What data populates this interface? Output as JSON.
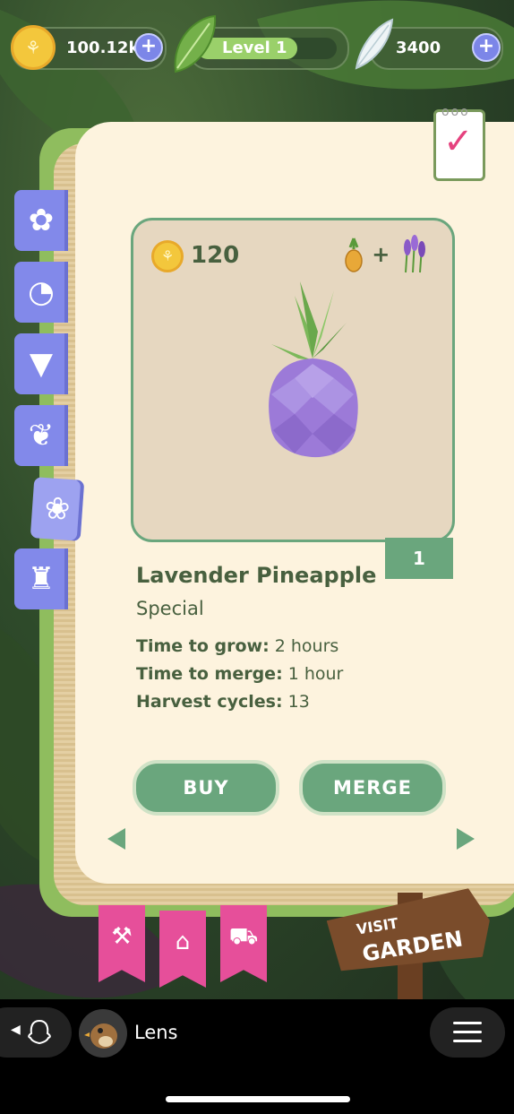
{
  "hud": {
    "coins": "100.12k",
    "level_label": "Level 1",
    "level_progress": 0.72,
    "feathers": "3400"
  },
  "categories": [
    {
      "icon": "flower-icon",
      "active": false
    },
    {
      "icon": "citrus-slice-icon",
      "active": false
    },
    {
      "icon": "carrot-icon",
      "active": false
    },
    {
      "icon": "herb-icon",
      "active": false
    },
    {
      "icon": "special-fruit-icon",
      "active": true
    },
    {
      "icon": "pedestal-icon",
      "active": false
    }
  ],
  "item": {
    "price": "120",
    "recipe": {
      "ingredient_a": "pineapple-icon",
      "operator": "+",
      "ingredient_b": "lavender-icon"
    },
    "count": "1",
    "name": "Lavender Pineapple",
    "category": "Special",
    "stats": [
      {
        "label": "Time to grow:",
        "value": "2 hours"
      },
      {
        "label": "Time to merge:",
        "value": "1 hour"
      },
      {
        "label": "Harvest cycles:",
        "value": "13"
      }
    ]
  },
  "actions": {
    "buy": "BUY",
    "merge": "MERGE"
  },
  "bottom_tabs": [
    "shovel-icon",
    "shop-icon",
    "cart-icon"
  ],
  "sign": {
    "line1": "VISIT",
    "line2": "GARDEN"
  },
  "snap_bar": {
    "lens_name": "Lens"
  },
  "colors": {
    "accent_green": "#6aa67d",
    "tab_purple": "#8289ea",
    "ribbon_pink": "#e64f9a"
  }
}
